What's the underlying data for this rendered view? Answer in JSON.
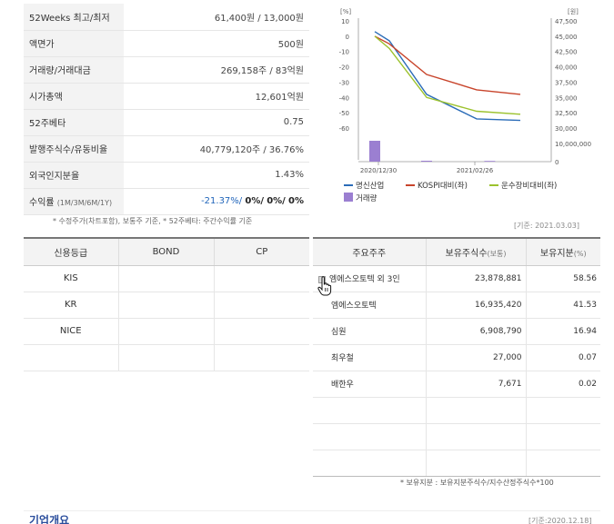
{
  "info_rows": [
    {
      "label": "52Weeks 최고/최저",
      "value": "61,400원 / 13,000원"
    },
    {
      "label": "액면가",
      "value": "500원"
    },
    {
      "label": "거래량/거래대금",
      "value": "269,158주 / 83억원"
    },
    {
      "label": "시가총액",
      "value": "12,601억원"
    },
    {
      "label": "52주베타",
      "value": "0.75"
    },
    {
      "label": "발행주식수/유동비율",
      "value": "40,779,120주 / 36.76%"
    },
    {
      "label": "외국인지분율",
      "value": "1.43%"
    }
  ],
  "return_row": {
    "label": "수익률",
    "label_sub": "(1M/3M/6M/1Y)",
    "v1": "-21.37%/",
    "v2": "0%/",
    "v3": "0%/",
    "v4": "0%"
  },
  "note_left": "* 수정주가(차트포함), 보통주 기준, * 52주베타: 주간수익률 기준",
  "note_right": "[기준: 2021.03.03]",
  "chart_data": {
    "type": "line",
    "left_unit": "[%]",
    "right_unit": "[원]",
    "left_ticks": [
      "10",
      "0",
      "-10",
      "-20",
      "-30",
      "-40",
      "-50",
      "-60"
    ],
    "right_ticks": [
      "47,500",
      "45,000",
      "42,500",
      "40,000",
      "37,500",
      "35,000",
      "32,500",
      "30,000"
    ],
    "volume_ticks": [
      "10,000,000",
      "0"
    ],
    "x_ticks": [
      "2020/12/30",
      "2021/02/26"
    ],
    "series": [
      {
        "name": "명신산업",
        "color": "#2b6cb8",
        "x": [
          0,
          1,
          2,
          3,
          4
        ],
        "y": [
          3,
          -3,
          -38,
          -54,
          -55
        ]
      },
      {
        "name": "KOSPI대비(좌)",
        "color": "#c8442b",
        "x": [
          0,
          1,
          2,
          3,
          4
        ],
        "y": [
          0,
          -5,
          -25,
          -35,
          -38
        ]
      },
      {
        "name": "운수장비대비(좌)",
        "color": "#9cc22d",
        "x": [
          0,
          1,
          2,
          3,
          4
        ],
        "y": [
          0,
          -8,
          -40,
          -49,
          -51
        ]
      }
    ],
    "volume": {
      "name": "거래량",
      "color": "#9b7fd1",
      "bars": [
        {
          "x": 0,
          "value": 11500000
        },
        {
          "x": 2,
          "value": 500000
        },
        {
          "x": 3.3,
          "value": 400000
        }
      ]
    },
    "ylim": [
      -60,
      10
    ],
    "y2lim": [
      30000,
      47500
    ]
  },
  "credit_table": {
    "headers": [
      "신용등급",
      "BOND",
      "CP"
    ],
    "rows": [
      [
        "KIS",
        "",
        ""
      ],
      [
        "KR",
        "",
        ""
      ],
      [
        "NICE",
        "",
        ""
      ],
      [
        "",
        "",
        ""
      ]
    ]
  },
  "holders_table": {
    "headers": [
      "주요주주",
      "보유주식수",
      "(보통)",
      "보유지분",
      "(%)"
    ],
    "rows": [
      {
        "name": "엠에스오토텍 외 3인",
        "shares": "23,878,881",
        "pct": "58.56"
      },
      {
        "name": "엠에스오토텍",
        "shares": "16,935,420",
        "pct": "41.53"
      },
      {
        "name": "심원",
        "shares": "6,908,790",
        "pct": "16.94"
      },
      {
        "name": "최우철",
        "shares": "27,000",
        "pct": "0.07"
      },
      {
        "name": "배한우",
        "shares": "7,671",
        "pct": "0.02"
      }
    ]
  },
  "footnote": "* 보유지분 : 보유지분주식수/지수산정주식수*100",
  "section_title": "기업개요",
  "section_date": "[기준:2020.12.18]",
  "icons": {
    "expand": "plus-square-icon",
    "cursor": "hand-pointer-icon"
  }
}
